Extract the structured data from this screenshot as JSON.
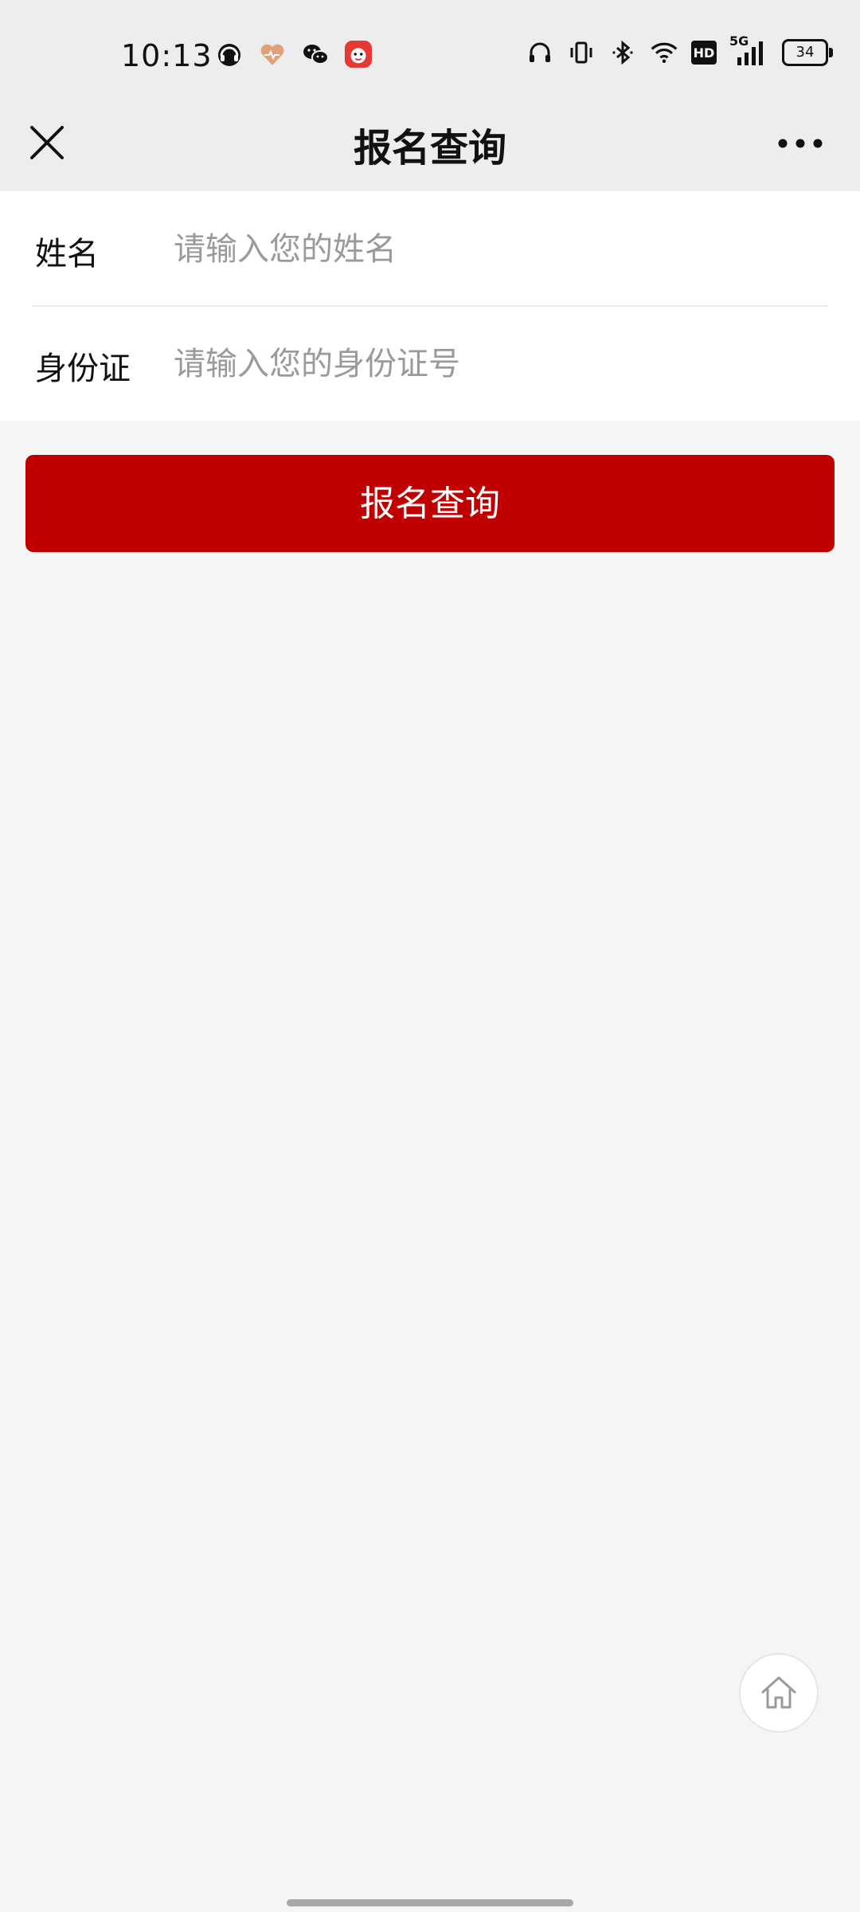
{
  "status_bar": {
    "time": "10:13",
    "left_icons": [
      "headphones-app-icon",
      "heart-health-icon",
      "wechat-icon",
      "red-app-icon"
    ],
    "right_icons": [
      "headset-icon",
      "vibrate-icon",
      "bluetooth-icon",
      "wifi-icon",
      "hd-icon",
      "signal-5g-icon"
    ],
    "hd_label": "HD",
    "network_label": "5G",
    "battery": "34"
  },
  "navbar": {
    "title": "报名查询",
    "close_icon": "close-icon",
    "more_icon": "more-dots-icon"
  },
  "form": {
    "name": {
      "label": "姓名",
      "placeholder": "请输入您的姓名",
      "value": ""
    },
    "id_card": {
      "label": "身份证",
      "placeholder": "请输入您的身份证号",
      "value": ""
    }
  },
  "submit": {
    "label": "报名查询"
  },
  "colors": {
    "accent": "#c00000",
    "header_bg": "#ededed",
    "page_bg": "#f5f5f5"
  },
  "home_button": {
    "icon": "home-icon"
  }
}
